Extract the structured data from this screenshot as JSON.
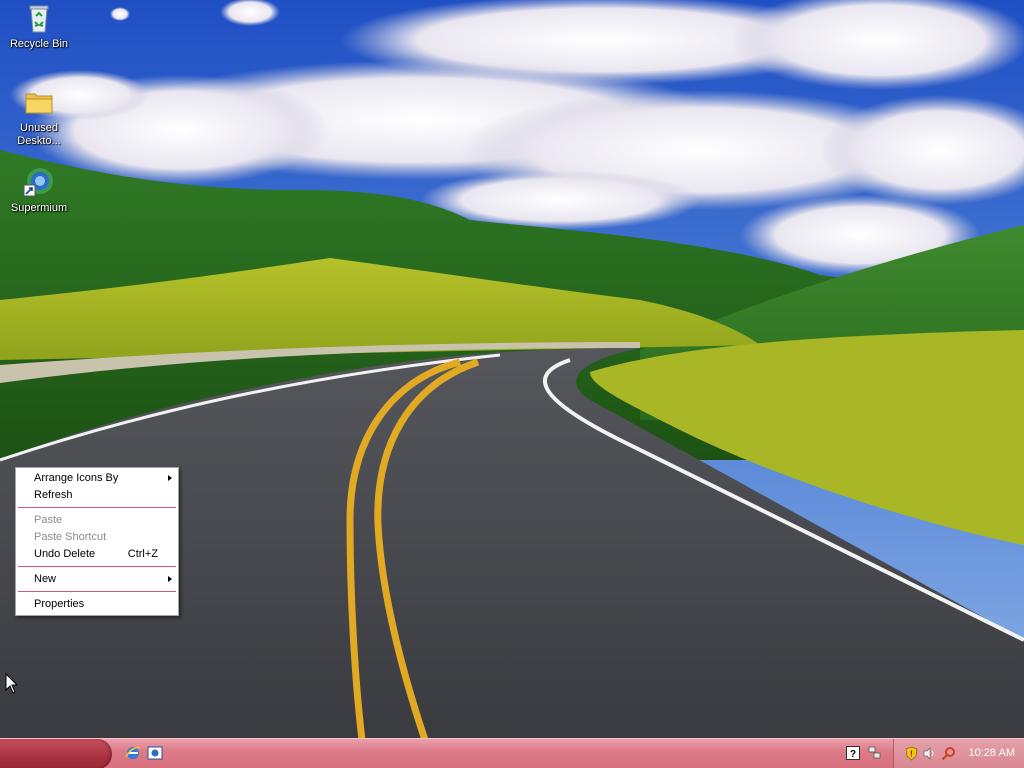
{
  "desktop": {
    "icons": [
      {
        "label": "Recycle Bin",
        "icon": "recycle-bin-icon"
      },
      {
        "label": "Unused Deskto...",
        "icon": "folder-icon"
      },
      {
        "label": "Supermium",
        "icon": "supermium-browser-icon"
      }
    ],
    "wallpaper": "green hills with winding road under cloudy blue sky"
  },
  "context_menu": {
    "items": {
      "arrange_icons_by": "Arrange Icons By",
      "refresh": "Refresh",
      "paste": "Paste",
      "paste_shortcut": "Paste Shortcut",
      "undo_delete": "Undo Delete",
      "undo_delete_shortcut": "Ctrl+Z",
      "new": "New",
      "properties": "Properties"
    }
  },
  "taskbar": {
    "quick_launch": [
      "internet-explorer-icon",
      "show-desktop-icon"
    ],
    "tray_icons": [
      "help-icon",
      "network-icon",
      "security-shield-icon",
      "volume-icon",
      "search-icon"
    ],
    "clock": "10:28 AM"
  },
  "colors": {
    "taskbar": "#dc7b88",
    "start_button": "#a8303f",
    "menu_separator": "#d05a74",
    "disabled_text": "#8c8c8c"
  }
}
